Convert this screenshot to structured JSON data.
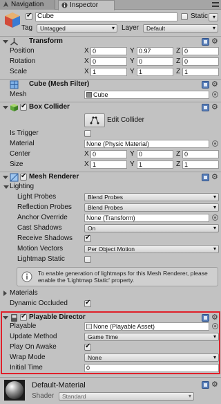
{
  "tabs": {
    "navigation": "Navigation",
    "inspector": "Inspector"
  },
  "object": {
    "name": "Cube",
    "static_label": "Static",
    "tag_label": "Tag",
    "tag_value": "Untagged",
    "layer_label": "Layer",
    "layer_value": "Default"
  },
  "transform": {
    "title": "Transform",
    "rows": [
      {
        "label": "Position",
        "x": "0",
        "y": "0.97",
        "z": "0"
      },
      {
        "label": "Rotation",
        "x": "0",
        "y": "0",
        "z": "0"
      },
      {
        "label": "Scale",
        "x": "1",
        "y": "1",
        "z": "1"
      }
    ]
  },
  "axes": {
    "x": "X",
    "y": "Y",
    "z": "Z"
  },
  "mesh_filter": {
    "title": "Cube (Mesh Filter)",
    "mesh_label": "Mesh",
    "mesh_value": "Cube"
  },
  "box_collider": {
    "title": "Box Collider",
    "edit_label": "Edit Collider",
    "is_trigger_label": "Is Trigger",
    "material_label": "Material",
    "material_value": "None (Physic Material)",
    "center_label": "Center",
    "center": {
      "x": "0",
      "y": "0",
      "z": "0"
    },
    "size_label": "Size",
    "size": {
      "x": "1",
      "y": "1",
      "z": "1"
    }
  },
  "mesh_renderer": {
    "title": "Mesh Renderer",
    "lighting_label": "Lighting",
    "light_probes_label": "Light Probes",
    "light_probes_value": "Blend Probes",
    "reflection_probes_label": "Reflection Probes",
    "reflection_probes_value": "Blend Probes",
    "anchor_override_label": "Anchor Override",
    "anchor_override_value": "None (Transform)",
    "cast_shadows_label": "Cast Shadows",
    "cast_shadows_value": "On",
    "receive_shadows_label": "Receive Shadows",
    "motion_vectors_label": "Motion Vectors",
    "motion_vectors_value": "Per Object Motion",
    "lightmap_static_label": "Lightmap Static",
    "info_text": "To enable generation of lightmaps for this Mesh Renderer, please enable the 'Lightmap Static' property.",
    "materials_label": "Materials",
    "dynamic_occluded_label": "Dynamic Occluded"
  },
  "playable_director": {
    "title": "Playable Director",
    "playable_label": "Playable",
    "playable_value": "None (Playable Asset)",
    "update_method_label": "Update Method",
    "update_method_value": "Game Time",
    "play_on_awake_label": "Play On Awake",
    "wrap_mode_label": "Wrap Mode",
    "wrap_mode_value": "None",
    "initial_time_label": "Initial Time",
    "initial_time_value": "0"
  },
  "material": {
    "name": "Default-Material",
    "shader_label": "Shader",
    "shader_value": "Standard"
  },
  "colors": {
    "highlight": "#e0202a",
    "panel": "#c2c2c2",
    "selected_text": "#1a1a1a"
  }
}
